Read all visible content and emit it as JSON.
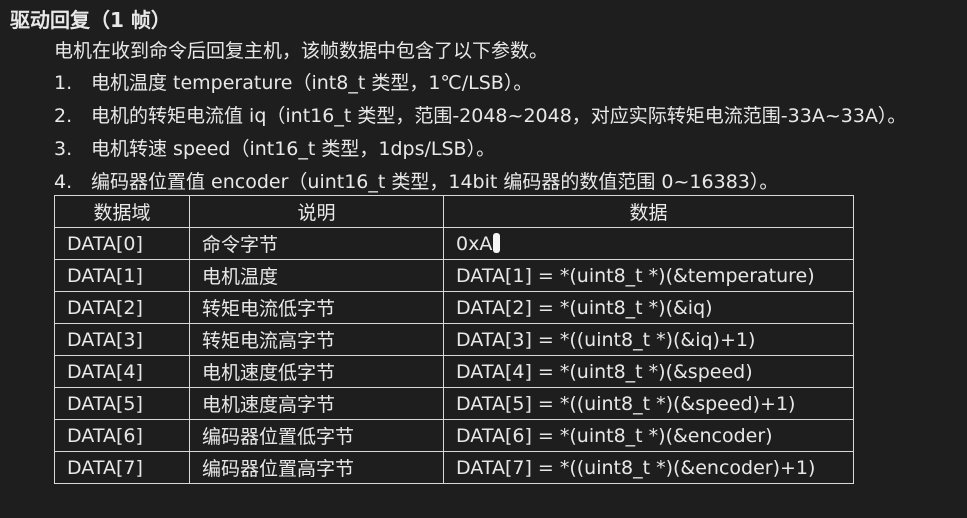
{
  "document": {
    "title": "驱动回复（1 帧）",
    "intro": "电机在收到命令后回复主机，该帧数据中包含了以下参数。",
    "params": [
      {
        "num": "1.",
        "text": "电机温度 temperature（int8_t 类型，1℃/LSB）。"
      },
      {
        "num": "2.",
        "text": "电机的转矩电流值 iq（int16_t 类型，范围-2048~2048，对应实际转矩电流范围-33A~33A）。"
      },
      {
        "num": "3.",
        "text": "电机转速 speed（int16_t 类型，1dps/LSB）。"
      },
      {
        "num": "4.",
        "text": "编码器位置值 encoder（uint16_t 类型，14bit 编码器的数值范围 0~16383）。"
      }
    ],
    "table": {
      "headers": [
        "数据域",
        "说明",
        "数据"
      ],
      "rows": [
        {
          "field": "DATA[0]",
          "desc": "命令字节",
          "data": "0xA"
        },
        {
          "field": "DATA[1]",
          "desc": "电机温度",
          "data": "DATA[1] = *(uint8_t *)(&temperature)"
        },
        {
          "field": "DATA[2]",
          "desc": "转矩电流低字节",
          "data": "DATA[2] = *(uint8_t *)(&iq)"
        },
        {
          "field": "DATA[3]",
          "desc": "转矩电流高字节",
          "data": "DATA[3] = *((uint8_t *)(&iq)+1)"
        },
        {
          "field": "DATA[4]",
          "desc": "电机速度低字节",
          "data": "DATA[4] = *(uint8_t *)(&speed)"
        },
        {
          "field": "DATA[5]",
          "desc": "电机速度高字节",
          "data": "DATA[5] = *((uint8_t *)(&speed)+1)"
        },
        {
          "field": "DATA[6]",
          "desc": "编码器位置低字节",
          "data": "DATA[6] = *(uint8_t *)(&encoder)"
        },
        {
          "field": "DATA[7]",
          "desc": "编码器位置高字节",
          "data": "DATA[7] = *((uint8_t *)(&encoder)+1)"
        }
      ]
    }
  },
  "colors": {
    "background": "#1e1e1e",
    "text": "#e8e8e8",
    "border": "#d8d8d8"
  }
}
